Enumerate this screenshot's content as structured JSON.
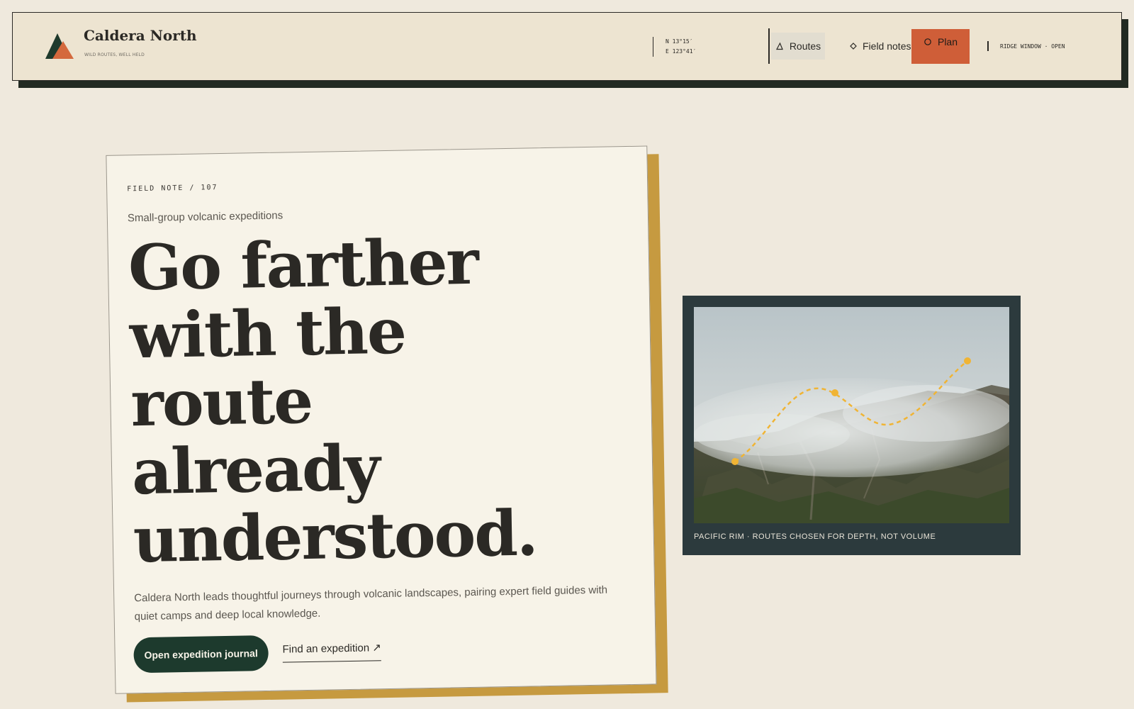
{
  "brand": {
    "name": "Caldera North",
    "tagline": "WILD ROUTES, WELL HELD",
    "logo": "mountain-logo-icon"
  },
  "header": {
    "coords": {
      "lat": "N 13°15′",
      "lon": "E 123°41′"
    },
    "nav": {
      "routes": {
        "label": "Routes",
        "icon": "triangle-icon"
      },
      "field_notes": {
        "label": "Field notes",
        "icon": "diamond-icon"
      },
      "plan": {
        "label": "Plan",
        "icon": "circle-icon"
      }
    },
    "status": "RIDGE WINDOW · OPEN"
  },
  "hero": {
    "kicker": "FIELD NOTE / 107",
    "subtitle": "Small-group volcanic expeditions",
    "headline": [
      "Go farther",
      "with the",
      "route",
      "already",
      "understood."
    ],
    "description": "Caldera North leads thoughtful journeys through volcanic landscapes, pairing expert field guides with quiet camps and deep local knowledge.",
    "primary_cta": "Open expedition journal",
    "secondary_cta": "Find an expedition ↗"
  },
  "photo": {
    "caption": "PACIFIC RIM · ROUTES CHOSEN FOR DEPTH, NOT VOLUME",
    "route_waypoints": 3
  },
  "colors": {
    "background": "#efe9dd",
    "header_bg": "#ede4d1",
    "ink": "#2b2925",
    "accent_orange": "#cf5e38",
    "forest_green": "#1d3a2d",
    "gold_shadow": "#c69a40",
    "panel_slate": "#2c3a3d",
    "route_gold": "#f0b434"
  }
}
